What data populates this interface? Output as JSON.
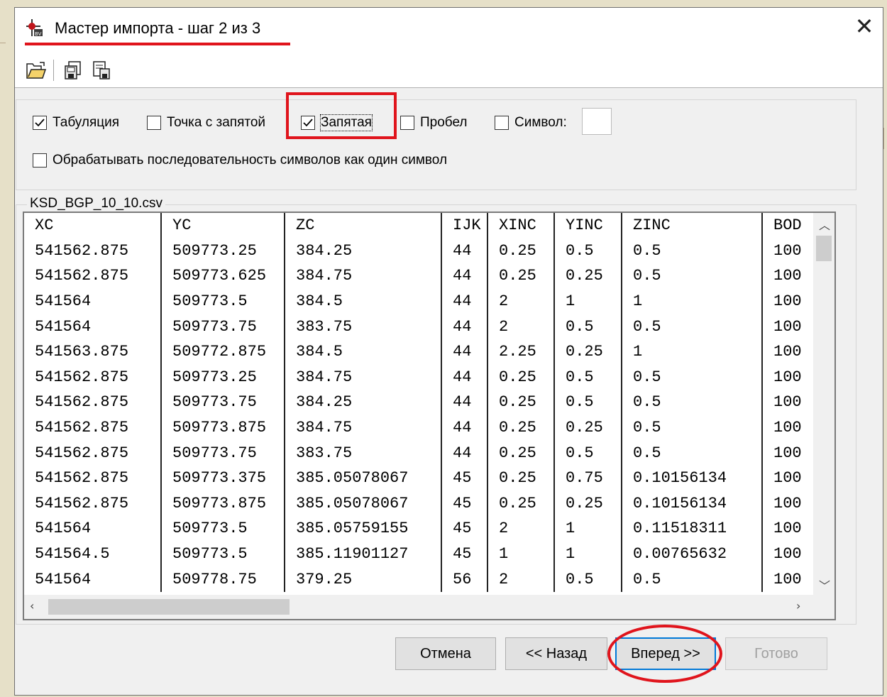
{
  "window": {
    "title": "Мастер импорта - шаг 2 из 3",
    "close_glyph": "✕",
    "accent_color": "#e0141c"
  },
  "toolbar": {
    "items": [
      "open-folder-icon",
      "save-settings-icon",
      "load-settings-icon"
    ]
  },
  "separators": {
    "options": [
      {
        "label": "Табуляция",
        "checked": true
      },
      {
        "label": "Точка с запятой",
        "checked": false
      },
      {
        "label": "Запятая",
        "checked": true
      },
      {
        "label": "Пробел",
        "checked": false
      },
      {
        "label": "Символ:",
        "checked": false
      }
    ],
    "symbol_value": "",
    "treat_consecutive": {
      "label": "Обрабатывать последовательность символов как один символ",
      "checked": false
    }
  },
  "file": {
    "name": "KSD_BGP_10_10.csv"
  },
  "grid": {
    "columns": [
      "XC",
      "YC",
      "ZC",
      "IJK",
      "XINC",
      "YINC",
      "ZINC",
      "BOD"
    ],
    "rows": [
      [
        "541562.875",
        "509773.25",
        "384.25",
        "44",
        "0.25",
        "0.5",
        "0.5",
        "100"
      ],
      [
        "541562.875",
        "509773.625",
        "384.75",
        "44",
        "0.25",
        "0.25",
        "0.5",
        "100"
      ],
      [
        "541564",
        "509773.5",
        "384.5",
        "44",
        "2",
        "1",
        "1",
        "100"
      ],
      [
        "541564",
        "509773.75",
        "383.75",
        "44",
        "2",
        "0.5",
        "0.5",
        "100"
      ],
      [
        "541563.875",
        "509772.875",
        "384.5",
        "44",
        "2.25",
        "0.25",
        "1",
        "100"
      ],
      [
        "541562.875",
        "509773.25",
        "384.75",
        "44",
        "0.25",
        "0.5",
        "0.5",
        "100"
      ],
      [
        "541562.875",
        "509773.75",
        "384.25",
        "44",
        "0.25",
        "0.5",
        "0.5",
        "100"
      ],
      [
        "541562.875",
        "509773.875",
        "384.75",
        "44",
        "0.25",
        "0.25",
        "0.5",
        "100"
      ],
      [
        "541562.875",
        "509773.75",
        "383.75",
        "44",
        "0.25",
        "0.5",
        "0.5",
        "100"
      ],
      [
        "541562.875",
        "509773.375",
        "385.05078067",
        "45",
        "0.25",
        "0.75",
        "0.10156134",
        "100"
      ],
      [
        "541562.875",
        "509773.875",
        "385.05078067",
        "45",
        "0.25",
        "0.25",
        "0.10156134",
        "100"
      ],
      [
        "541564",
        "509773.5",
        "385.05759155",
        "45",
        "2",
        "1",
        "0.11518311",
        "100"
      ],
      [
        "541564.5",
        "509773.5",
        "385.11901127",
        "45",
        "1",
        "1",
        "0.00765632",
        "100"
      ],
      [
        "541564",
        "509778.75",
        "379.25",
        "56",
        "2",
        "0.5",
        "0.5",
        "100"
      ]
    ]
  },
  "buttons": {
    "cancel": "Отмена",
    "back": "<< Назад",
    "next": "Вперед >>",
    "finish": "Готово"
  }
}
